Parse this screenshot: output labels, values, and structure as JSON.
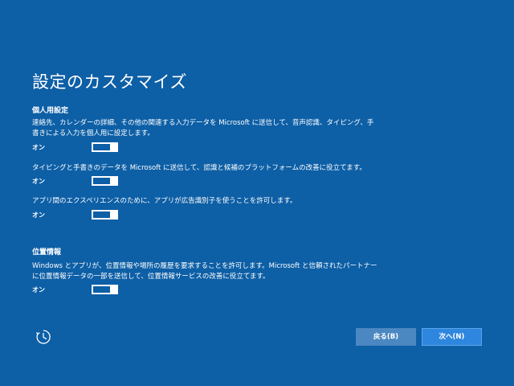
{
  "page": {
    "title": "設定のカスタマイズ",
    "background": "#0d5fa6",
    "accent": "#2e86de"
  },
  "personalization": {
    "heading": "個人用設定",
    "settings": [
      {
        "description": "連絡先、カレンダーの詳細、その他の関連する入力データを Microsoft に送信して、音声認識、タイピング、手書きによる入力を個人用に設定します。",
        "state_label": "オン",
        "on": true
      },
      {
        "description": "タイピングと手書きのデータを Microsoft に送信して、認識と候補のプラットフォームの改善に役立てます。",
        "state_label": "オン",
        "on": true
      },
      {
        "description": "アプリ間のエクスペリエンスのために、アプリが広告識別子を使うことを許可します。",
        "state_label": "オン",
        "on": true
      }
    ]
  },
  "location": {
    "heading": "位置情報",
    "settings": [
      {
        "description": "Windows とアプリが、位置情報や場所の履歴を要求することを許可します。Microsoft と信頼されたパートナーに位置情報データの一部を送信して、位置情報サービスの改善に役立てます。",
        "state_label": "オン",
        "on": true
      }
    ]
  },
  "footer": {
    "accessibility_icon": "ease-of-access-icon",
    "back_label": "戻る(B)",
    "next_label": "次へ(N)"
  }
}
